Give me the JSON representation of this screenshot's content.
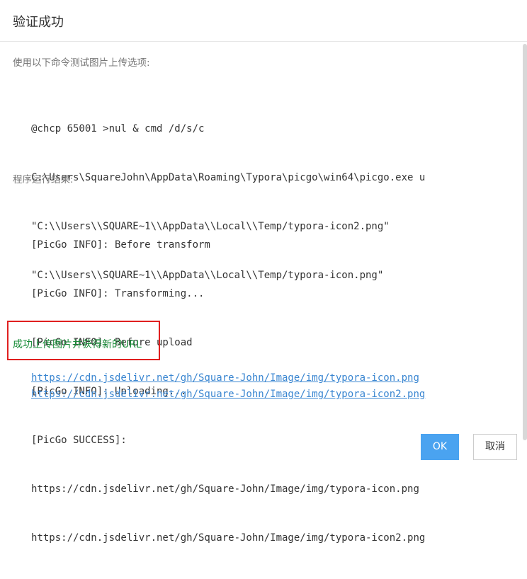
{
  "dialog": {
    "title": "验证成功",
    "test_label": "使用以下命令测试图片上传选项:",
    "command_lines": [
      "@chcp 65001 >nul & cmd /d/s/c",
      "C:\\Users\\SquareJohn\\AppData\\Roaming\\Typora\\picgo\\win64\\picgo.exe u",
      "\"C:\\\\Users\\\\SQUARE~1\\\\AppData\\\\Local\\\\Temp/typora-icon2.png\"",
      "\"C:\\\\Users\\\\SQUARE~1\\\\AppData\\\\Local\\\\Temp/typora-icon.png\""
    ],
    "result_label": "程序运行结果:",
    "output_lines": [
      "[PicGo INFO]: Before transform",
      "[PicGo INFO]: Transforming...",
      "[PicGo INFO]: Before upload",
      "[PicGo INFO]: Uploading...",
      "[PicGo SUCCESS]:",
      "https://cdn.jsdelivr.net/gh/Square-John/Image/img/typora-icon.png",
      "https://cdn.jsdelivr.net/gh/Square-John/Image/img/typora-icon2.png"
    ],
    "success_message": "成功上传图片并获得新的URL",
    "links": [
      "https://cdn.jsdelivr.net/gh/Square-John/Image/img/typora-icon.png",
      "https://cdn.jsdelivr.net/gh/Square-John/Image/img/typora-icon2.png"
    ],
    "ok_label": "OK",
    "cancel_label": "取消"
  },
  "colors": {
    "success_text": "#1a8d3a",
    "highlight_border": "#e02020",
    "link": "#3a86d1",
    "ok_button": "#4aa3f0"
  }
}
